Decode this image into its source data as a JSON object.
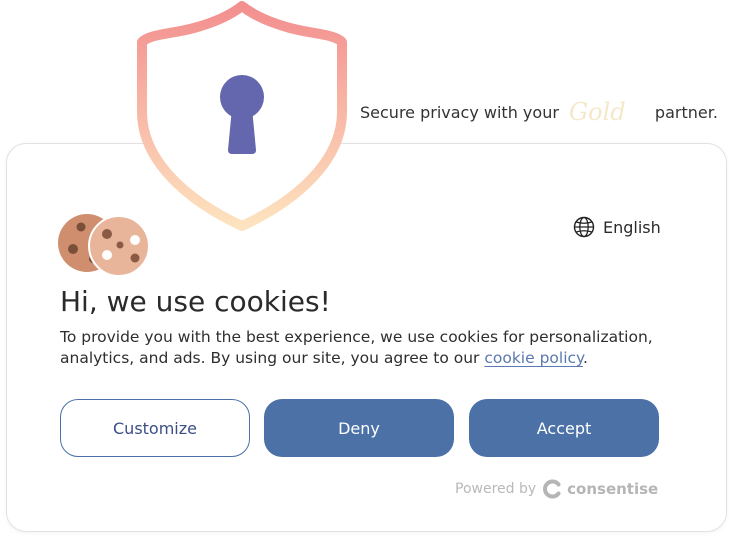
{
  "tagline": {
    "before": "Secure privacy with your",
    "script_word": "Gold",
    "after": "partner."
  },
  "language": {
    "icon": "globe-icon",
    "label": "English"
  },
  "banner": {
    "icon": "cookie-icon",
    "title": "Hi, we use cookies!",
    "description_before": "To provide you with the best experience, we use cookies for personalization, analytics, and ads. By using our site, you agree to our ",
    "policy_link": "cookie policy",
    "description_after": "."
  },
  "buttons": {
    "customize": "Customize",
    "deny": "Deny",
    "accept": "Accept"
  },
  "footer": {
    "powered_by": "Powered by",
    "brand": "consentise",
    "brand_icon": "consentise-logo-icon"
  },
  "colors": {
    "primary": "#4b71a7",
    "customize_text": "#3b4f86",
    "link": "#5b78b0",
    "shield_gradient_top": "#f38f8f",
    "shield_gradient_bottom": "#fde3bf",
    "keyhole": "#6466ae"
  }
}
